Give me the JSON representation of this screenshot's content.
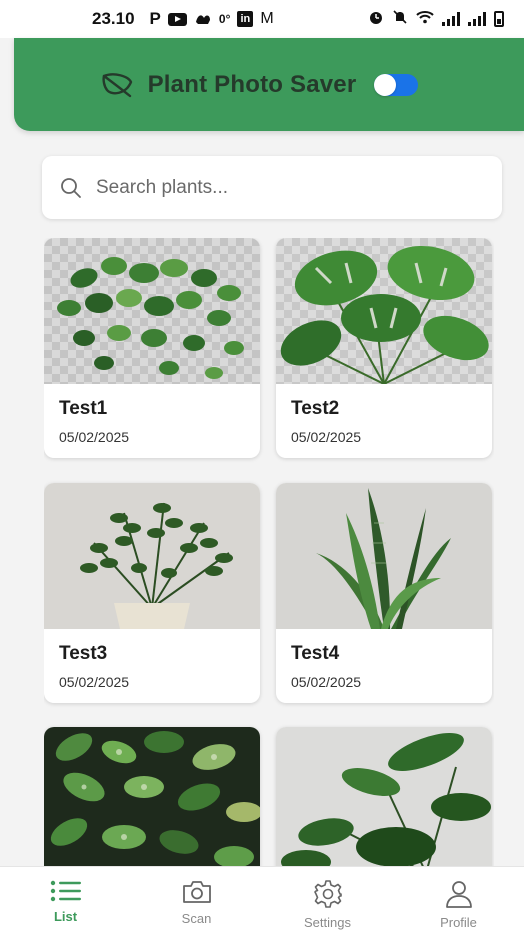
{
  "status_bar": {
    "time": "23.10",
    "p_label": "P",
    "temp": "0°",
    "mail": "M",
    "in_label": "in"
  },
  "header": {
    "title": "Plant Photo Saver",
    "toggle_on": true,
    "color": "#3d9a5b"
  },
  "search": {
    "placeholder": "Search plants...",
    "value": ""
  },
  "plants": [
    {
      "name": "Test1",
      "date": "05/02/2025",
      "photo": "pothos-hanging"
    },
    {
      "name": "Test2",
      "date": "05/02/2025",
      "photo": "monstera"
    },
    {
      "name": "Test3",
      "date": "05/02/2025",
      "photo": "zz-plant"
    },
    {
      "name": "Test4",
      "date": "05/02/2025",
      "photo": "snake-plant"
    },
    {
      "name": "",
      "date": "",
      "photo": "variegated-leaves"
    },
    {
      "name": "",
      "date": "",
      "photo": "philodendron"
    }
  ],
  "nav": {
    "items": [
      {
        "label": "List",
        "icon": "list-icon",
        "active": true
      },
      {
        "label": "Scan",
        "icon": "camera-icon",
        "active": false
      },
      {
        "label": "Settings",
        "icon": "gear-icon",
        "active": false
      },
      {
        "label": "Profile",
        "icon": "person-icon",
        "active": false
      }
    ],
    "active_color": "#3d9a5b"
  }
}
